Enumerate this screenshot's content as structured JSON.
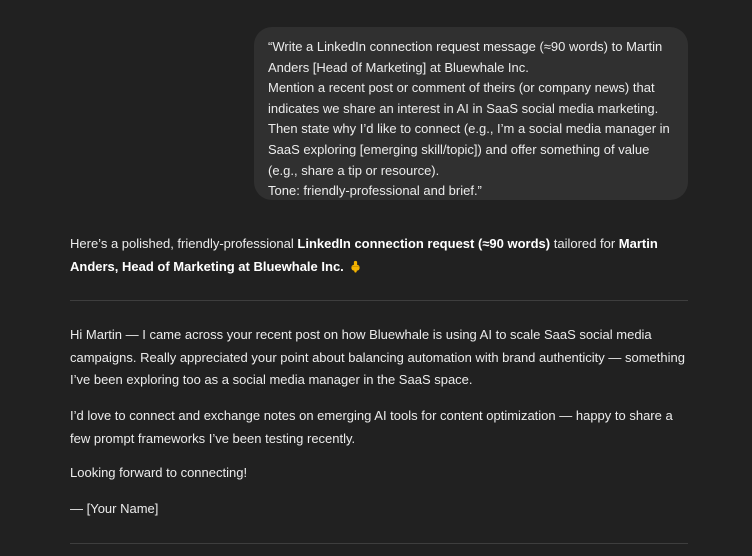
{
  "user_message": {
    "lines": [
      "“Write a LinkedIn connection request message (≈90 words) to Martin",
      "Anders [Head of Marketing] at Bluewhale Inc.",
      "Mention a recent post or comment of theirs (or company news) that",
      "indicates we share an interest in AI in SaaS social media marketing.",
      "Then state why I’d like to connect (e.g., I’m a social media manager in",
      "SaaS exploring [emerging skill/topic]) and offer something of value",
      "(e.g., share a tip or resource).",
      "Tone: friendly-professional and brief.”"
    ]
  },
  "assistant": {
    "intro_prefix": "Here’s a polished, friendly-professional ",
    "intro_bold1": "LinkedIn connection request (≈90 words)",
    "intro_mid": " tailored for ",
    "intro_bold2_line1": "Martin",
    "intro_bold2_line2": "Anders, Head of Marketing at Bluewhale Inc.",
    "emoji_icon": "pointing-down-hand-icon",
    "message": {
      "p1_line1": "Hi Martin — I came across your recent post on how Bluewhale is using AI to scale SaaS social media",
      "p1_line2": "campaigns. Really appreciated your point about balancing automation with brand authenticity — something",
      "p1_line3": "I’ve been exploring too as a social media manager in the SaaS space.",
      "p2_line1": "I’d love to connect and exchange notes on emerging AI tools for content optimization — happy to share a",
      "p2_line2": "few prompt frameworks I’ve been testing recently.",
      "p3": "Looking forward to connecting!",
      "p4": "— [Your Name]"
    }
  },
  "colors": {
    "background": "#212121",
    "bubble": "#303030",
    "text": "#ececec",
    "divider": "#3e3e3e",
    "emoji": "#f4b400"
  }
}
